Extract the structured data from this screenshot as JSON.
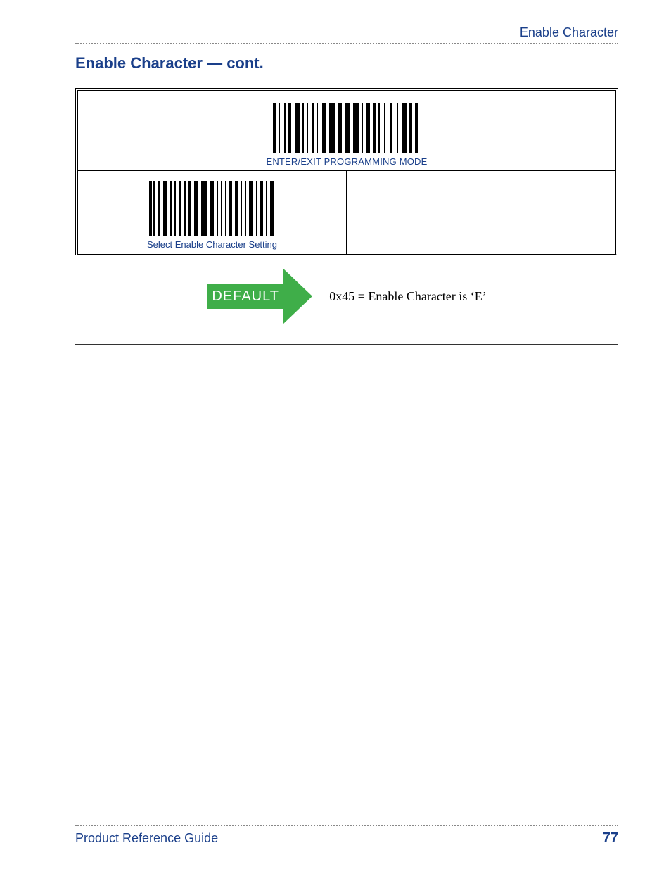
{
  "header": {
    "section_label": "Enable Character"
  },
  "title": "Enable Character — cont.",
  "barcodes": {
    "top_caption": "ENTER/EXIT PROGRAMMING MODE",
    "left_caption": "Select Enable Character Setting"
  },
  "default": {
    "label": "DEFAULT",
    "text": "0x45 = Enable Character is ‘E’"
  },
  "footer": {
    "doc_title": "Product Reference Guide",
    "page_number": "77"
  }
}
